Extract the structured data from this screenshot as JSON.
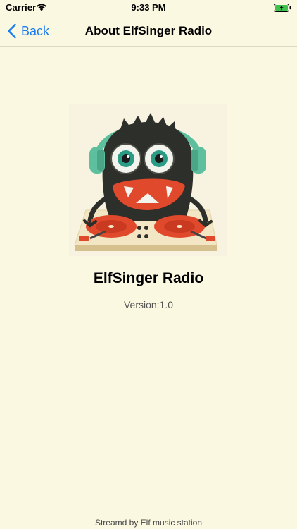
{
  "status_bar": {
    "carrier": "Carrier",
    "time": "9:33 PM",
    "wifi_icon": "wifi-icon",
    "battery_icon": "battery-charging-icon"
  },
  "nav": {
    "back_label": "Back",
    "title": "About ElfSinger Radio",
    "tint_color": "#1a7cf0"
  },
  "content": {
    "logo_icon": "monster-dj-logo",
    "app_name": "ElfSinger Radio",
    "version": "Version:1.0"
  },
  "footer": {
    "text": "Streamd by Elf music station"
  },
  "colors": {
    "background": "#faf8e1",
    "monster": "#2d2f2a",
    "headphones": "#5dbf9e",
    "turntable": "#e0492c"
  }
}
